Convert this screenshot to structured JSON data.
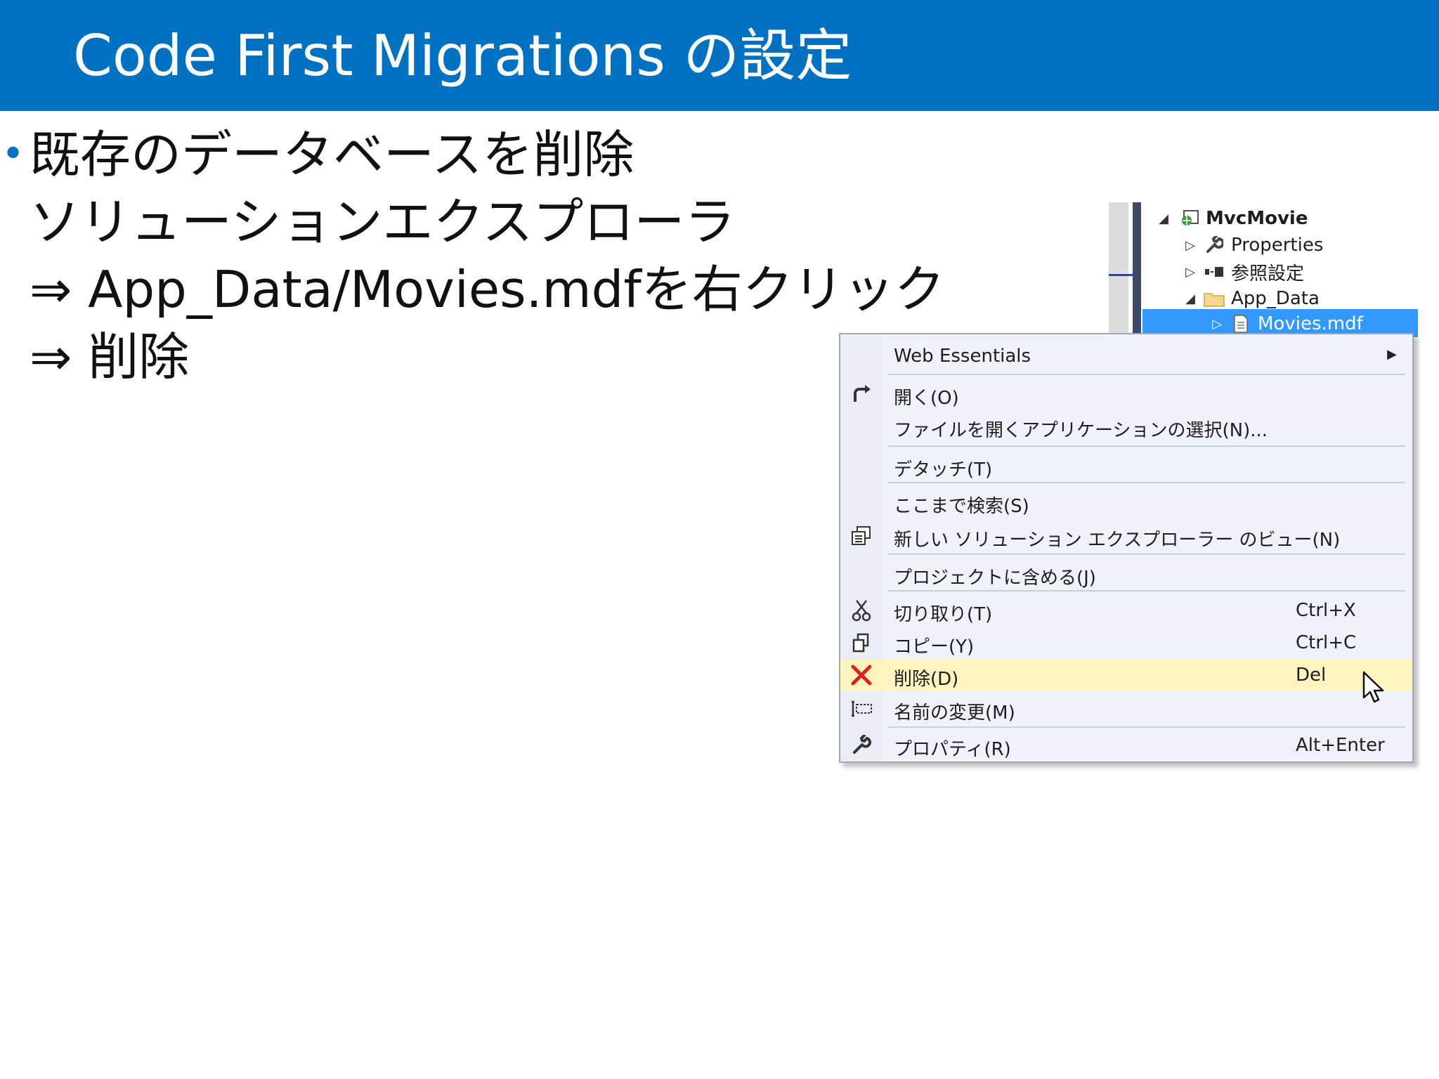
{
  "slide": {
    "title": "Code First Migrations の設定",
    "lines": [
      "既存のデータベースを削除",
      "ソリューションエクスプローラ",
      "⇒ App_Data/Movies.mdfを右クリック",
      "⇒ 削除"
    ]
  },
  "solution_explorer": {
    "items": [
      {
        "label": "MvcMovie",
        "icon": "project-icon",
        "expander": "expanded"
      },
      {
        "label": "Properties",
        "icon": "wrench-icon",
        "expander": "collapsed"
      },
      {
        "label": "参照設定",
        "icon": "references-icon",
        "expander": "collapsed"
      },
      {
        "label": "App_Data",
        "icon": "folder-icon",
        "expander": "expanded"
      },
      {
        "label": "Movies.mdf",
        "icon": "file-icon",
        "expander": "collapsed",
        "selected": true
      }
    ]
  },
  "context_menu": {
    "items": [
      {
        "label": "Web Essentials",
        "shortcut": "",
        "icon": "",
        "submenu": true
      },
      {
        "label": "開く(O)",
        "shortcut": "",
        "icon": "open-arrow-icon"
      },
      {
        "label": "ファイルを開くアプリケーションの選択(N)...",
        "shortcut": "",
        "icon": ""
      },
      {
        "label": "デタッチ(T)",
        "shortcut": "",
        "icon": ""
      },
      {
        "label": "ここまで検索(S)",
        "shortcut": "",
        "icon": ""
      },
      {
        "label": "新しい ソリューション エクスプローラー のビュー(N)",
        "shortcut": "",
        "icon": "new-view-icon"
      },
      {
        "label": "プロジェクトに含める(J)",
        "shortcut": "",
        "icon": ""
      },
      {
        "label": "切り取り(T)",
        "shortcut": "Ctrl+X",
        "icon": "scissors-icon"
      },
      {
        "label": "コピー(Y)",
        "shortcut": "Ctrl+C",
        "icon": "copy-icon"
      },
      {
        "label": "削除(D)",
        "shortcut": "Del",
        "icon": "delete-x-icon",
        "highlighted": true
      },
      {
        "label": "名前の変更(M)",
        "shortcut": "",
        "icon": "rename-icon"
      },
      {
        "label": "プロパティ(R)",
        "shortcut": "Alt+Enter",
        "icon": "wrench-icon"
      }
    ]
  },
  "colors": {
    "title_bar": "#0070c0",
    "menu_background": "#eef2fa",
    "menu_highlight": "#fdf4bf",
    "selection": "#3399ff",
    "delete_icon": "#e0201b"
  }
}
